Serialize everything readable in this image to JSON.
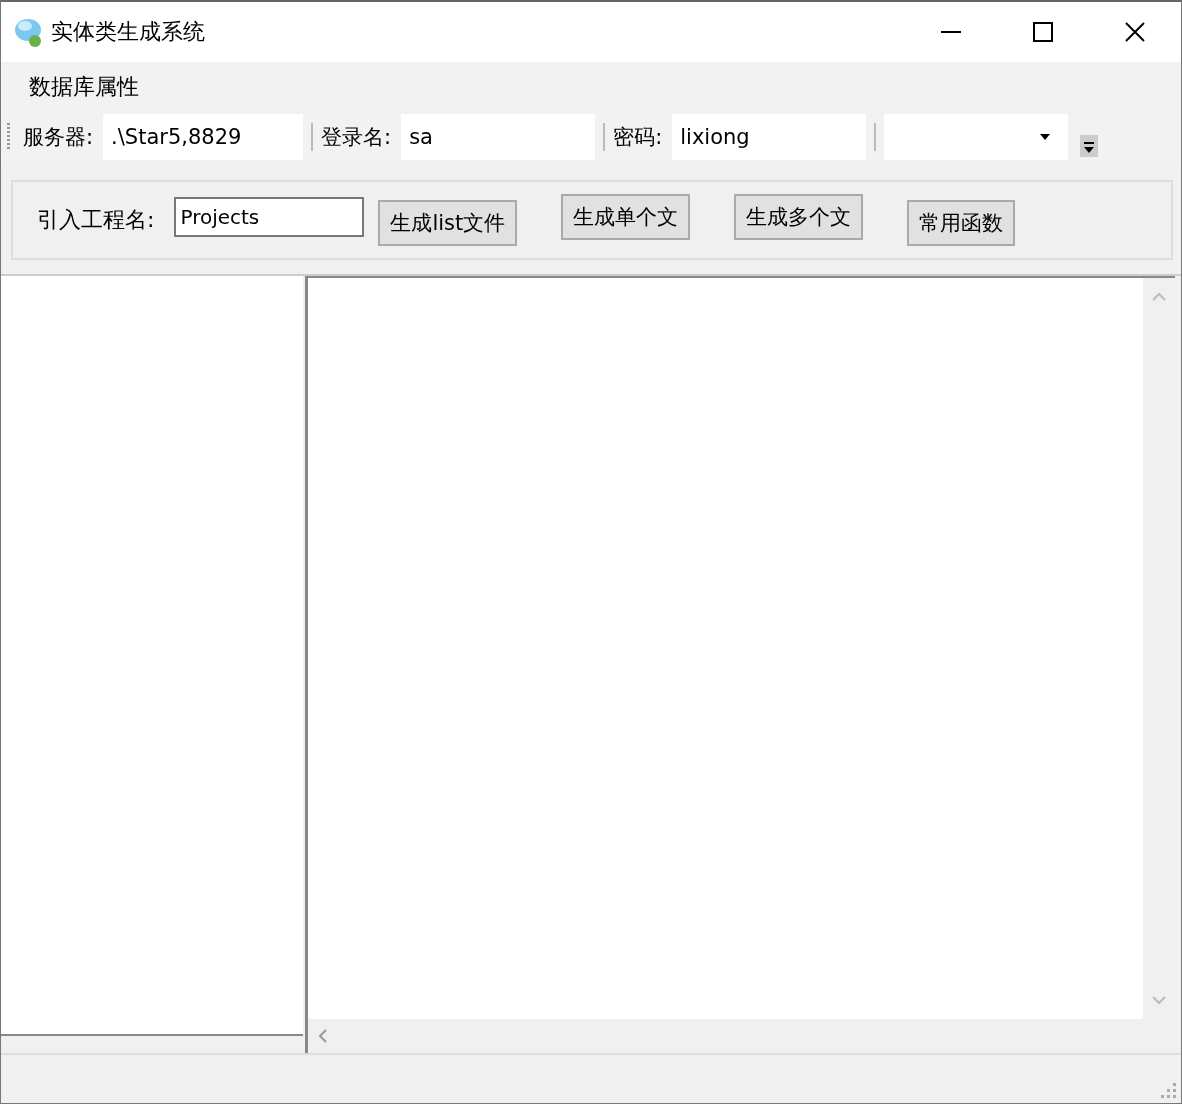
{
  "window": {
    "title": "实体类生成系统"
  },
  "menu": [
    {
      "label": "数据库属性"
    }
  ],
  "toolbar": {
    "fields": [
      {
        "label": "服务器:",
        "value": ".\\Star5,8829"
      },
      {
        "label": "登录名:",
        "value": "sa"
      },
      {
        "label": "密码:",
        "value": "lixiong"
      }
    ],
    "combo": {
      "expanded": false
    }
  },
  "panel": {
    "project_label": "引入工程名:",
    "project_value": "Projects",
    "buttons": [
      {
        "label": "生成list文件"
      },
      {
        "label": "生成单个文"
      },
      {
        "label": "生成多个文"
      },
      {
        "label": "常用函数"
      }
    ]
  }
}
